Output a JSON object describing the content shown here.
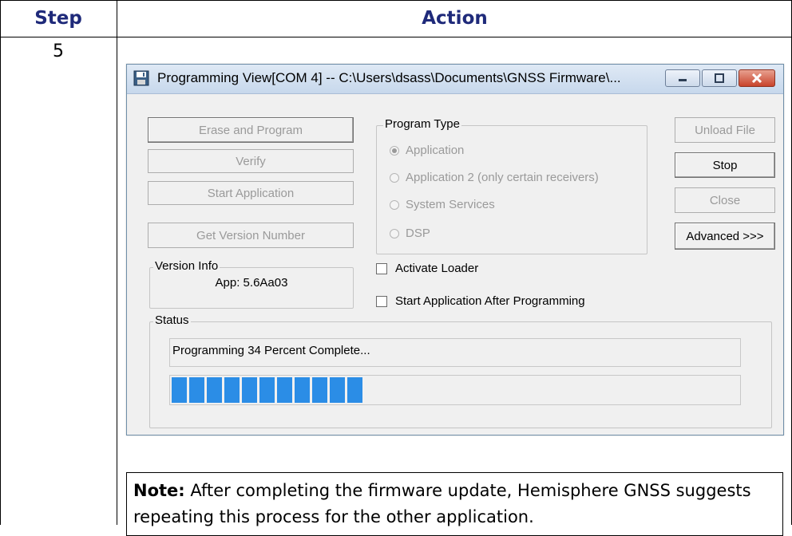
{
  "table": {
    "headers": [
      "Step",
      "Action"
    ],
    "step_number": "5"
  },
  "window": {
    "title": "Programming View[COM 4] -- C:\\Users\\dsass\\Documents\\GNSS Firmware\\...",
    "icon": "floppy-disk-icon",
    "titlebar_buttons": [
      "minimize-icon",
      "maximize-icon",
      "close-icon"
    ]
  },
  "left_buttons": {
    "erase_program": "Erase and Program",
    "verify": "Verify",
    "start_application": "Start Application",
    "get_version": "Get Version Number"
  },
  "program_type": {
    "label": "Program Type",
    "options": [
      "Application",
      "Application 2 (only certain receivers)",
      "System Services",
      "DSP"
    ],
    "selected": "Application"
  },
  "right_buttons": {
    "unload_file": "Unload File",
    "stop": "Stop",
    "close": "Close",
    "advanced": "Advanced >>>"
  },
  "version_info": {
    "label": "Version Info",
    "value": "App: 5.6Aa03"
  },
  "checkboxes": {
    "activate_loader": "Activate Loader",
    "start_after_programming": "Start Application After Programming"
  },
  "status": {
    "label": "Status",
    "message": "Programming 34 Percent Complete...",
    "progress_fraction": 0.34
  },
  "note": {
    "bold": "Note:",
    "text": " After completing the firmware update, Hemisphere GNSS suggests repeating this process for the other application."
  },
  "colors": {
    "header_text": "#1f2a7a",
    "progress": "#2b8de6",
    "close_button": "#c8432b"
  }
}
